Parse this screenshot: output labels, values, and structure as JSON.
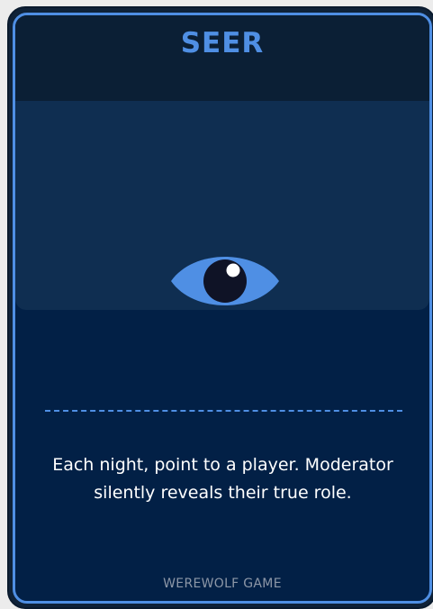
{
  "card": {
    "role_title": "SEER",
    "description": "Each night, point to a player. Moderator silently reveals their true role.",
    "footer": "WEREWOLF GAME",
    "icon": "eye-icon"
  },
  "colors": {
    "accent": "#4f8fe4",
    "card_background": "#022046",
    "title_bar_background": "#0b1f35",
    "art_background": "#0f2e51",
    "footer_text": "#8d97a7",
    "pupil": "#0f1326"
  }
}
